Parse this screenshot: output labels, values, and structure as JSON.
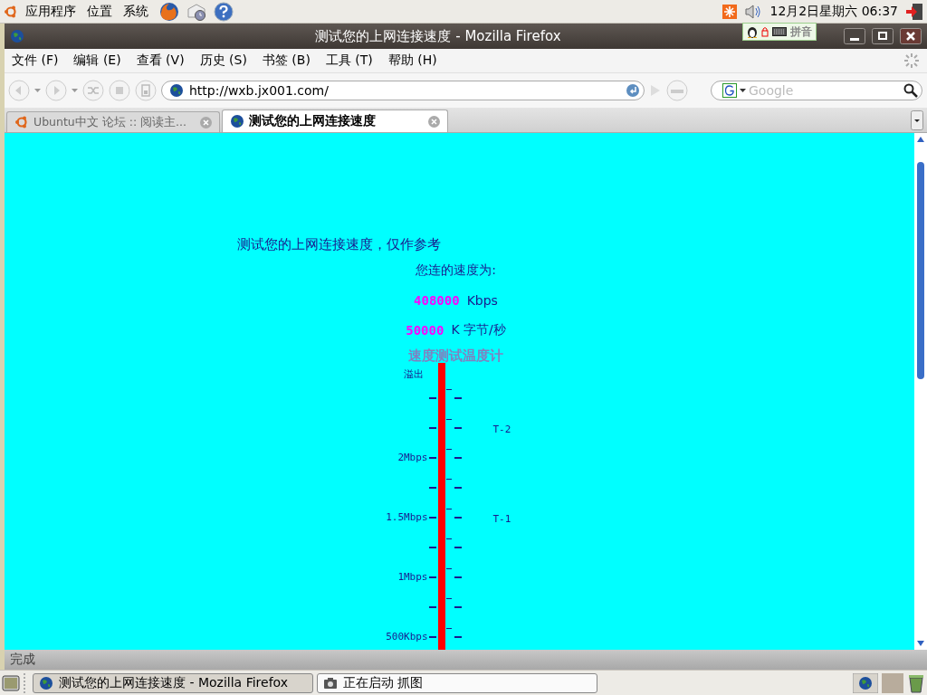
{
  "top_panel": {
    "menus": [
      "应用程序",
      "位置",
      "系统"
    ],
    "clock": "12月2日星期六 06:37"
  },
  "ime_bar": {
    "label": "拼音"
  },
  "window": {
    "title": "测试您的上网连接速度 - Mozilla Firefox"
  },
  "menu_bar": [
    "文件 (F)",
    "编辑 (E)",
    "查看 (V)",
    "历史 (S)",
    "书签 (B)",
    "工具 (T)",
    "帮助 (H)"
  ],
  "nav": {
    "url": "http://wxb.jx001.com/",
    "search_placeholder": "Google"
  },
  "tabs": [
    {
      "label": "Ubuntu中文 论坛 :: 阅读主...",
      "selected": false,
      "kind": "ubuntu"
    },
    {
      "label": "测试您的上网连接速度",
      "selected": true,
      "kind": "globe"
    }
  ],
  "page": {
    "intro": "测试您的上网连接速度，仅作参考",
    "speed_label": "您连的速度为:",
    "kbps_value": "408000",
    "kbps_unit": "Kbps",
    "bytes_value": "50000",
    "bytes_unit": "K 字节/秒",
    "thermometer": {
      "title": "速度测试温度计",
      "overflow_label": "溢出",
      "rows": [
        {},
        {
          "side_label": "T-2"
        },
        {
          "label": "2Mbps"
        },
        {},
        {
          "label": "1.5Mbps",
          "side_label": "T-1"
        },
        {},
        {
          "label": "1Mbps"
        },
        {},
        {
          "label": "500Kbps"
        }
      ]
    }
  },
  "status_bar": {
    "text": "完成"
  },
  "taskbar": {
    "items": [
      {
        "label": "测试您的上网连接速度 - Mozilla Firefox",
        "selected": true,
        "kind": "globe"
      },
      {
        "label": "正在启动 抓图",
        "selected": false,
        "kind": "camera"
      }
    ]
  }
}
